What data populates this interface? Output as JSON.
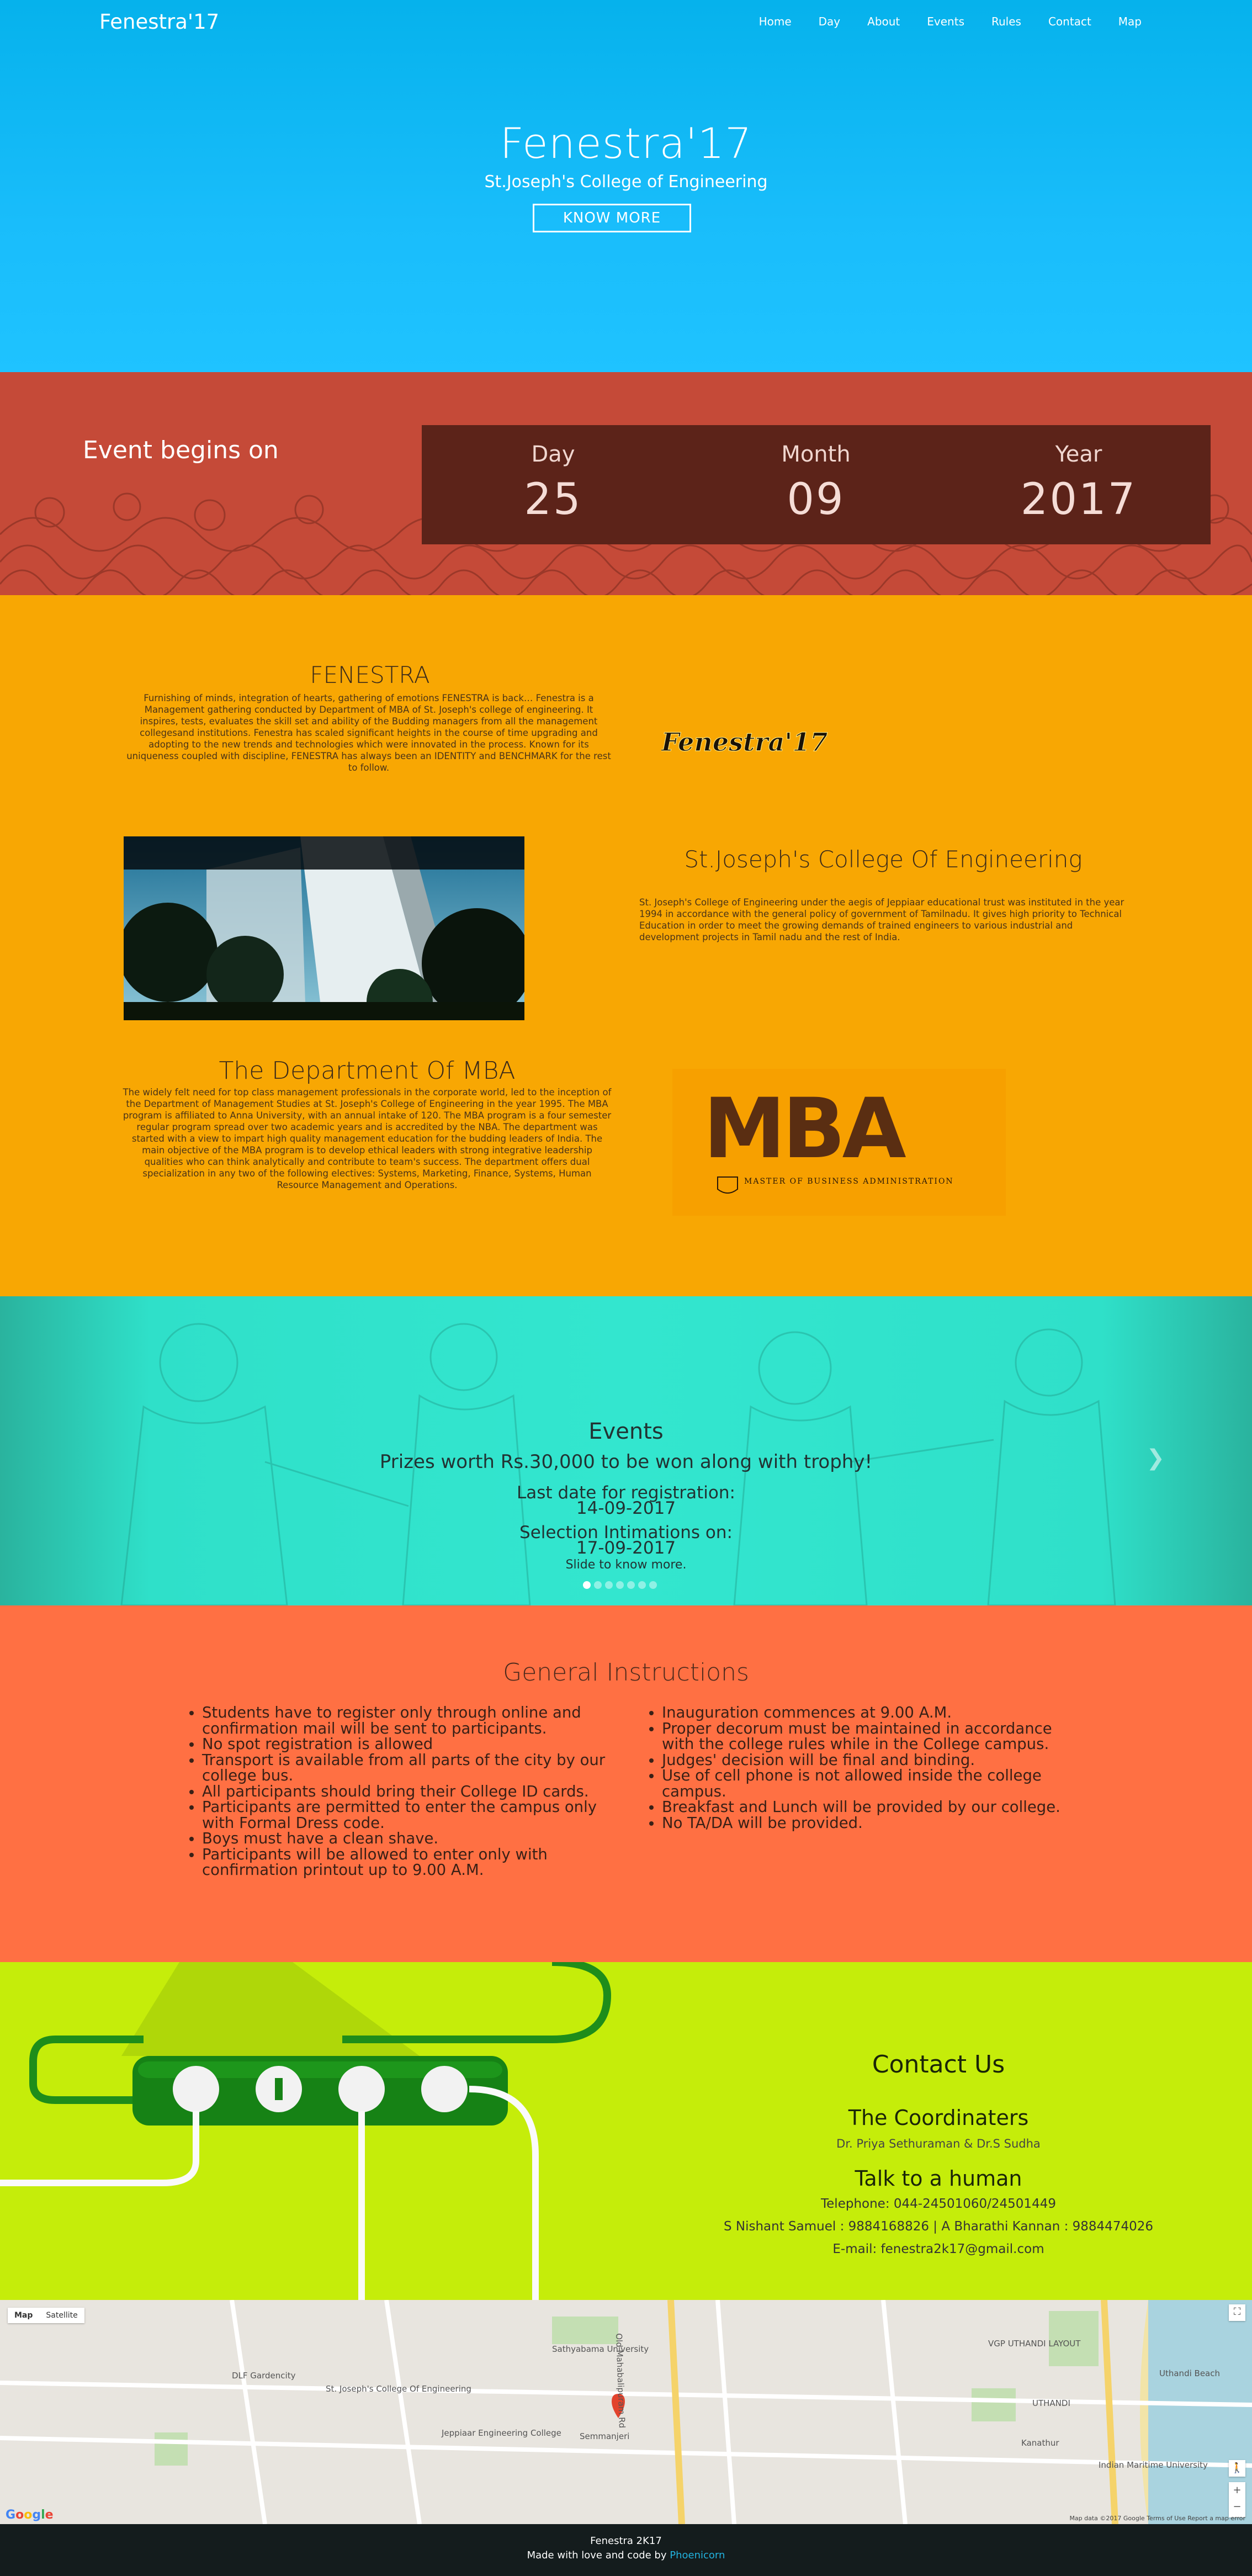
{
  "nav": {
    "brand": "Fenestra'17",
    "links": [
      "Home",
      "Day",
      "About",
      "Events",
      "Rules",
      "Contact",
      "Map"
    ]
  },
  "hero": {
    "title": "Fenestra'17",
    "subtitle": "St.Joseph's College of Engineering",
    "button": "KNOW MORE"
  },
  "countdown": {
    "label": "Event begins on",
    "day_label": "Day",
    "day": "25",
    "month_label": "Month",
    "month": "09",
    "year_label": "Year",
    "year": "2017"
  },
  "about": {
    "fenestra_title": "FENESTRA",
    "fenestra_text": "Furnishing of minds, integration of hearts, gathering of emotions FENESTRA is back… Fenestra is a Management gathering conducted by Department of MBA of St. Joseph's college of engineering. It inspires, tests, evaluates the skill set and ability of the Budding managers from all the management collegesand institutions. Fenestra has scaled significant heights in the course of time upgrading and adopting to the new trends and technologies which were innovated in the process. Known for its uniqueness coupled with discipline, FENESTRA has always been an IDENTITY and BENCHMARK for the rest to follow.",
    "fenestra_logo": "Fenestra'17",
    "college_title": "St.Joseph's College Of Engineering",
    "college_text": "St. Joseph's College of Engineering under the aegis of Jeppiaar educational trust was instituted in the year 1994 in accordance with the general policy of government of Tamilnadu. It gives high priority to Technical Education in order to meet the growing demands of trained engineers to various industrial and development projects in Tamil nadu and the rest of India.",
    "mba_title": "The Department Of MBA",
    "mba_text": "The widely felt need for top class management professionals in the corporate world, led to the inception of the Department of Management Studies at St. Joseph's College of Engineering in the year 1995. The MBA program is affiliated to Anna University, with an annual intake of 120. The MBA program is a four semester regular program spread over two academic years and is accredited by the NBA. The department was started with a view to impart high quality management education for the budding leaders of India. The main objective of the MBA program is to develop ethical leaders with strong integrative leadership qualities who can think analytically and contribute to team's success. The department offers dual specialization in any two of the following electives: Systems, Marketing, Finance, Systems, Human Resource Management and Operations.",
    "mba_logo_text": "MBA",
    "mba_logo_sub": "MASTER OF BUSINESS ADMINISTRATION"
  },
  "events": {
    "title": "Events",
    "prize": "Prizes worth Rs.30,000 to be won along with trophy!",
    "reg_label": "Last date for registration:",
    "reg_date": "14-09-2017",
    "sel_label": "Selection Intimations on:",
    "sel_date": "17-09-2017",
    "slide": "Slide to know more."
  },
  "instructions": {
    "title": "General Instructions",
    "left": [
      "Students have to register only through online and confirmation mail will be sent to participants.",
      "No spot registration is allowed",
      "Transport is available from all parts of the city by our college bus.",
      "All participants should bring their College ID cards.",
      "Participants are permitted to enter the campus only with Formal Dress code.",
      "Boys must have a clean shave.",
      "Participants will be allowed to enter only with confirmation printout up to 9.00 A.M."
    ],
    "right": [
      "Inauguration commences at 9.00 A.M.",
      "Proper decorum must be maintained in accordance with the college rules while in the College campus.",
      "Judges' decision will be final and binding.",
      "Use of cell phone is not allowed inside the college campus.",
      "Breakfast and Lunch will be provided by our college.",
      "No TA/DA will be provided."
    ]
  },
  "contact": {
    "title": "Contact Us",
    "coord_title": "The Coordinaters",
    "coordinators": "Dr. Priya Sethuraman & Dr.S Sudha",
    "talk_title": "Talk to a human",
    "telephone": "Telephone: 044-24501060/24501449",
    "students": "S Nishant Samuel : 9884168826 | A Bharathi Kannan : 9884474026",
    "email": "E-mail: fenestra2k17@gmail.com"
  },
  "map": {
    "type_map": "Map",
    "type_satellite": "Satellite",
    "labels": {
      "sathyabama": "Sathyabama University",
      "dlf": "DLF Gardencity",
      "sjce": "St. Joseph's College Of Engineering",
      "jeppiaar": "Jeppiaar Engineering College",
      "semmanjeri": "Semmanjeri",
      "vgp": "VGP UTHANDI LAYOUT",
      "uthandi_beach": "Uthandi Beach",
      "uthandi": "UTHANDI",
      "kanathur": "Kanathur",
      "imu": "Indian Maritime University",
      "omr": "Old Mahabalipuram Rd"
    },
    "attribution": "Map data ©2017 Google   Terms of Use   Report a map error",
    "google": "Google"
  },
  "footer": {
    "line1": "Fenestra 2K17",
    "line2": "Made with love and code by",
    "credit": "Phoenicorn"
  }
}
